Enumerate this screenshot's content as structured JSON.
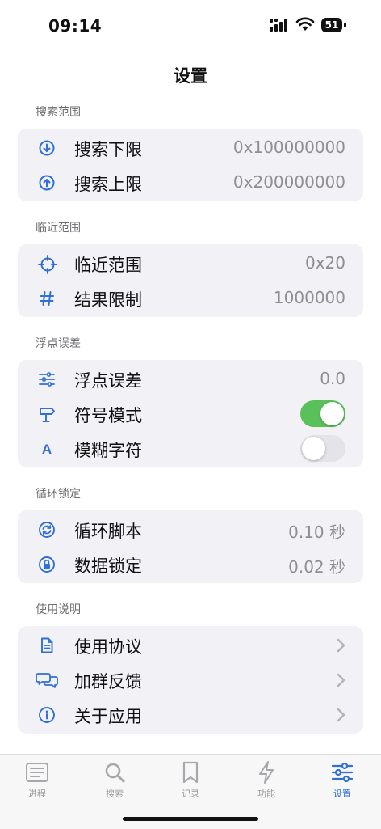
{
  "status_bar": {
    "time": "09:14",
    "battery": "51"
  },
  "title": "设置",
  "sections": [
    {
      "header": "搜索范围",
      "rows": [
        {
          "icon": "arrow-down-circle-icon",
          "label": "搜索下限",
          "value": "0x100000000"
        },
        {
          "icon": "arrow-up-circle-icon",
          "label": "搜索上限",
          "value": "0x200000000"
        }
      ]
    },
    {
      "header": "临近范围",
      "rows": [
        {
          "icon": "crosshair-icon",
          "label": "临近范围",
          "value": "0x20"
        },
        {
          "icon": "number-sign-icon",
          "label": "结果限制",
          "value": "1000000"
        }
      ]
    },
    {
      "header": "浮点误差",
      "rows": [
        {
          "icon": "sliders-icon",
          "label": "浮点误差",
          "value": "0.0"
        },
        {
          "icon": "signpost-icon",
          "label": "符号模式",
          "toggle": true
        },
        {
          "icon": "letter-a-icon",
          "label": "模糊字符",
          "toggle": false
        }
      ]
    },
    {
      "header": "循环锁定",
      "rows": [
        {
          "icon": "refresh-circle-icon",
          "label": "循环脚本",
          "value": "0.10 秒"
        },
        {
          "icon": "lock-circle-icon",
          "label": "数据锁定",
          "value": "0.02 秒"
        }
      ]
    },
    {
      "header": "使用说明",
      "rows": [
        {
          "icon": "document-icon",
          "label": "使用协议"
        },
        {
          "icon": "chat-bubbles-icon",
          "label": "加群反馈"
        },
        {
          "icon": "info-circle-icon",
          "label": "关于应用"
        }
      ]
    }
  ],
  "tabs": [
    {
      "icon": "list-icon",
      "label": "进程",
      "active": false
    },
    {
      "icon": "search-icon",
      "label": "搜索",
      "active": false
    },
    {
      "icon": "bookmark-icon",
      "label": "记录",
      "active": false
    },
    {
      "icon": "bolt-icon",
      "label": "功能",
      "active": false
    },
    {
      "icon": "settings-sliders-icon",
      "label": "设置",
      "active": true
    }
  ],
  "colors": {
    "accent": "#2f6fd6",
    "toggle_on": "#5ac15a",
    "toggle_off": "#e3e3e8",
    "group_bg": "#f1f1f6"
  }
}
